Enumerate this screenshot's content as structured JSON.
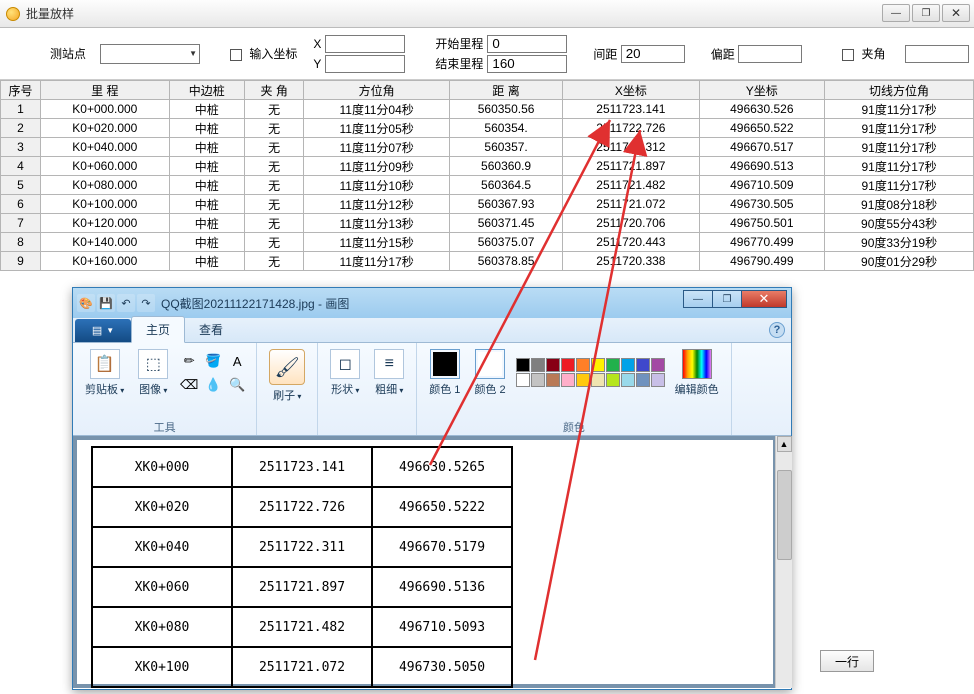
{
  "window": {
    "title": "批量放样",
    "min_icon": "—",
    "max_icon": "❐",
    "close_icon": "✕"
  },
  "form": {
    "station_label": "测站点",
    "input_coord_label": "输入坐标",
    "x_label": "X",
    "y_label": "Y",
    "start_mileage_label": "开始里程",
    "end_mileage_label": "结束里程",
    "start_mileage_value": "0",
    "end_mileage_value": "160",
    "spacing_label": "间距",
    "spacing_value": "20",
    "offset_label": "偏距",
    "offset_value": "",
    "include_angle_label": "夹角",
    "include_angle_value": ""
  },
  "table": {
    "headers": [
      "序号",
      "里 程",
      "中边桩",
      "夹 角",
      "方位角",
      "距 离",
      "X坐标",
      "Y坐标",
      "切线方位角"
    ],
    "rows": [
      [
        "1",
        "K0+000.000",
        "中桩",
        "无",
        "11度11分04秒",
        "560350.56",
        "2511723.141",
        "496630.526",
        "91度11分17秒"
      ],
      [
        "2",
        "K0+020.000",
        "中桩",
        "无",
        "11度11分05秒",
        "560354.",
        "2511722.726",
        "496650.522",
        "91度11分17秒"
      ],
      [
        "3",
        "K0+040.000",
        "中桩",
        "无",
        "11度11分07秒",
        "560357.",
        "2511722.312",
        "496670.517",
        "91度11分17秒"
      ],
      [
        "4",
        "K0+060.000",
        "中桩",
        "无",
        "11度11分09秒",
        "560360.9",
        "2511721.897",
        "496690.513",
        "91度11分17秒"
      ],
      [
        "5",
        "K0+080.000",
        "中桩",
        "无",
        "11度11分10秒",
        "560364.5",
        "2511721.482",
        "496710.509",
        "91度11分17秒"
      ],
      [
        "6",
        "K0+100.000",
        "中桩",
        "无",
        "11度11分12秒",
        "560367.93",
        "2511721.072",
        "496730.505",
        "91度08分18秒"
      ],
      [
        "7",
        "K0+120.000",
        "中桩",
        "无",
        "11度11分13秒",
        "560371.45",
        "2511720.706",
        "496750.501",
        "90度55分43秒"
      ],
      [
        "8",
        "K0+140.000",
        "中桩",
        "无",
        "11度11分15秒",
        "560375.07",
        "2511720.443",
        "496770.499",
        "90度33分19秒"
      ],
      [
        "9",
        "K0+160.000",
        "中桩",
        "无",
        "11度11分17秒",
        "560378.85",
        "2511720.338",
        "496790.499",
        "90度01分29秒"
      ]
    ]
  },
  "paint": {
    "title": "QQ截图20211122171428.jpg - 画图",
    "file_menu": "",
    "tab_home": "主页",
    "tab_view": "查看",
    "clipboard_label": "剪贴板",
    "image_label": "图像",
    "tools_label": "工具",
    "brush_label": "刷子",
    "shapes_label": "形状",
    "thickness_label": "粗细",
    "color1_label": "颜色 1",
    "color2_label": "颜色 2",
    "colors_label": "颜色",
    "edit_colors_label": "编辑颜色",
    "palette_row1": [
      "#000",
      "#7f7f7f",
      "#880015",
      "#ed1c24",
      "#ff7f27",
      "#fff200",
      "#22b14c",
      "#00a2e8",
      "#3f48cc",
      "#a349a4"
    ],
    "palette_row2": [
      "#fff",
      "#c3c3c3",
      "#b97a57",
      "#ffaec9",
      "#ffc90e",
      "#efe4b0",
      "#b5e61d",
      "#99d9ea",
      "#7092be",
      "#c8bfe7"
    ]
  },
  "inner_table": {
    "rows": [
      [
        "XK0+000",
        "2511723.141",
        "496630.5265"
      ],
      [
        "XK0+020",
        "2511722.726",
        "496650.5222"
      ],
      [
        "XK0+040",
        "2511722.311",
        "496670.5179"
      ],
      [
        "XK0+060",
        "2511721.897",
        "496690.5136"
      ],
      [
        "XK0+080",
        "2511721.482",
        "496710.5093"
      ],
      [
        "XK0+100",
        "2511721.072",
        "496730.5050"
      ]
    ]
  },
  "row_button": "一行"
}
